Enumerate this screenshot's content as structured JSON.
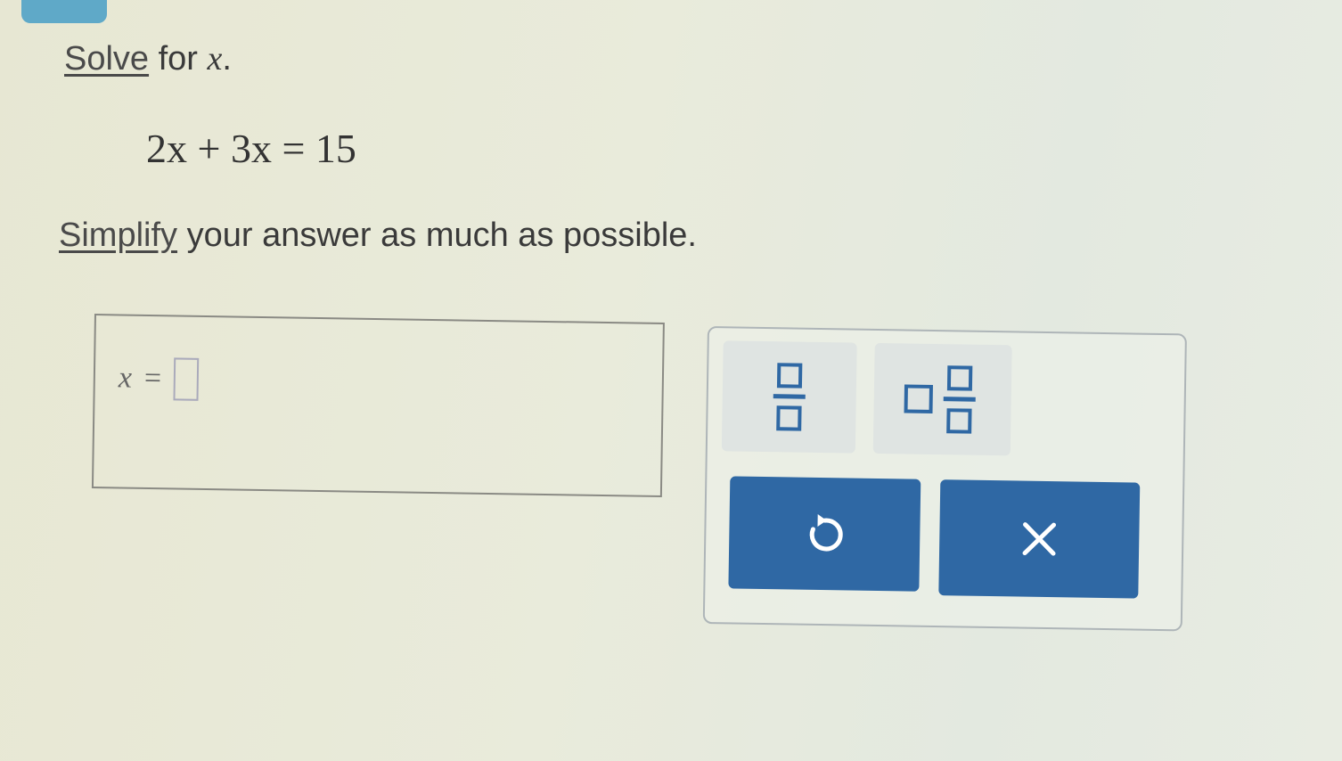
{
  "problem": {
    "solve_word": "Solve",
    "solve_rest": " for ",
    "solve_var": "x",
    "solve_end": ".",
    "equation": "2x + 3x = 15",
    "simplify_word": "Simplify",
    "simplify_rest": " your answer as much as possible."
  },
  "answer": {
    "variable": "x",
    "equals": "=",
    "value": ""
  },
  "keypad": {
    "keys": [
      "fraction",
      "mixed-number",
      "undo",
      "clear"
    ]
  },
  "colors": {
    "key_blue": "#2f68a4",
    "key_gray": "#dfe4e2",
    "tab_blue": "#5fa9c8"
  }
}
